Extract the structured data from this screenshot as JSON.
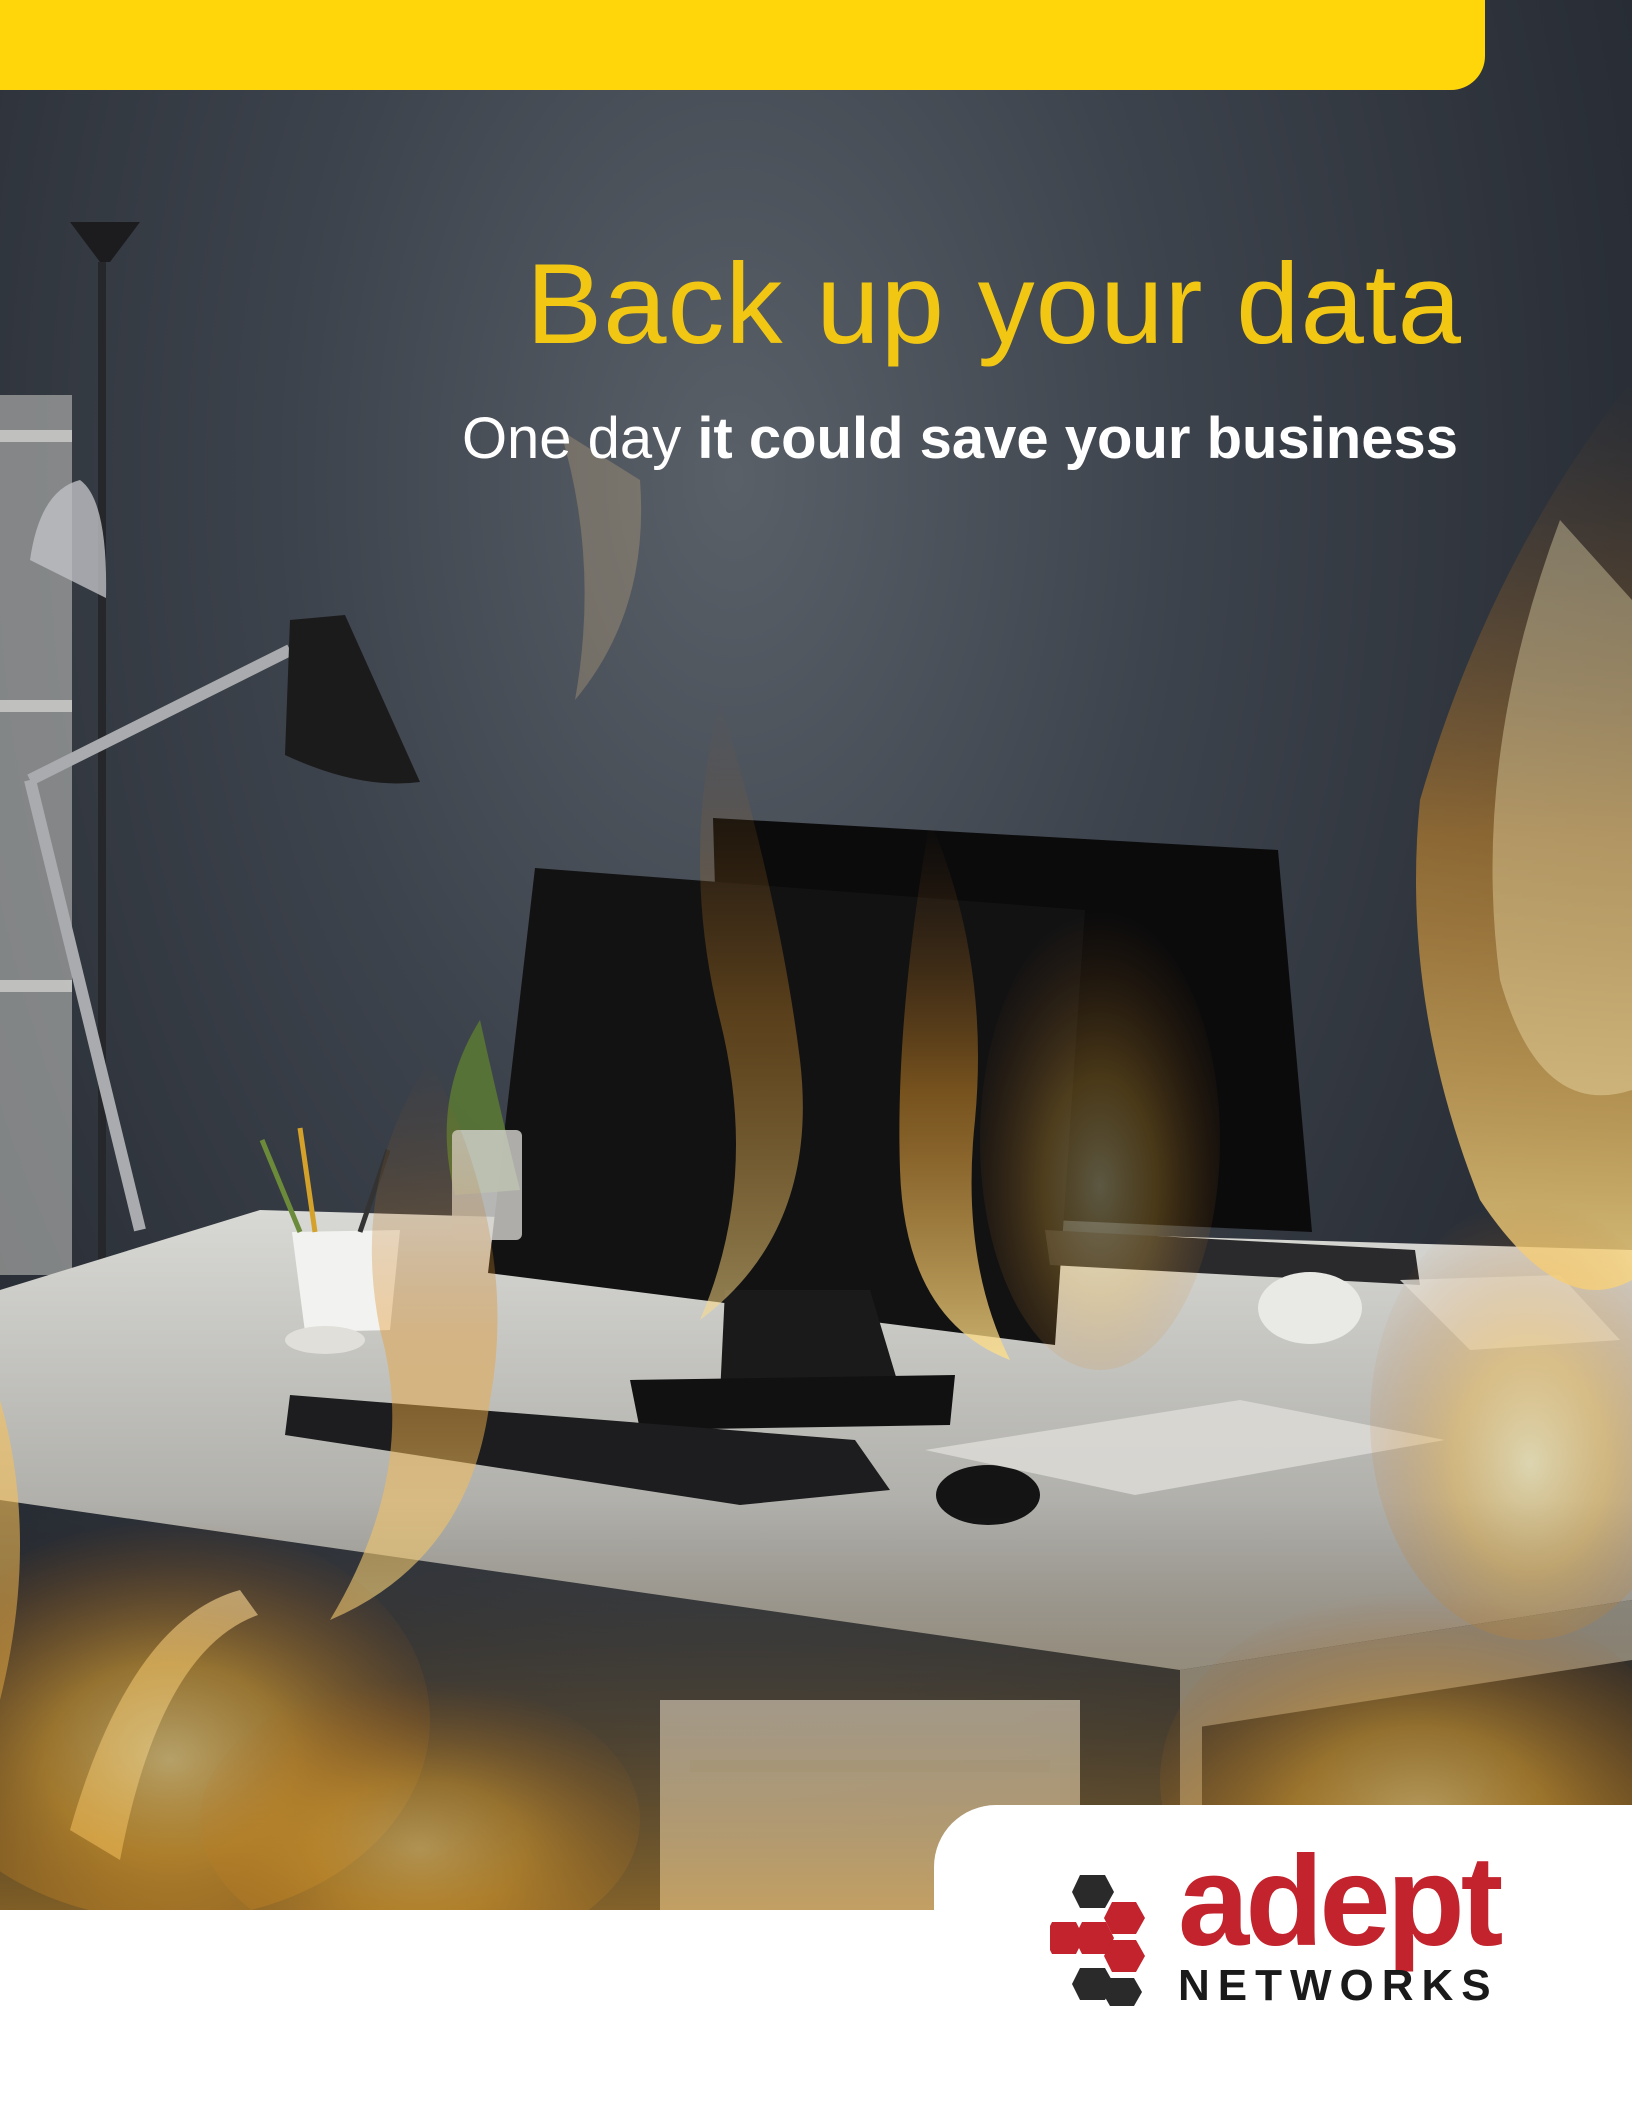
{
  "cover": {
    "headline": "Back up your data",
    "subhead_light": "One day ",
    "subhead_bold": "it could save your business"
  },
  "brand": {
    "wordmark": "adept",
    "wordmark_sub": "NETWORKS",
    "logo_icon": "adept-hexagon-icon"
  },
  "colors": {
    "accent_yellow": "#FFD60A",
    "headline_yellow": "#F2C713",
    "brand_red": "#C2232D"
  },
  "photo": {
    "subject": "office desk with computer monitors engulfed in flames"
  }
}
